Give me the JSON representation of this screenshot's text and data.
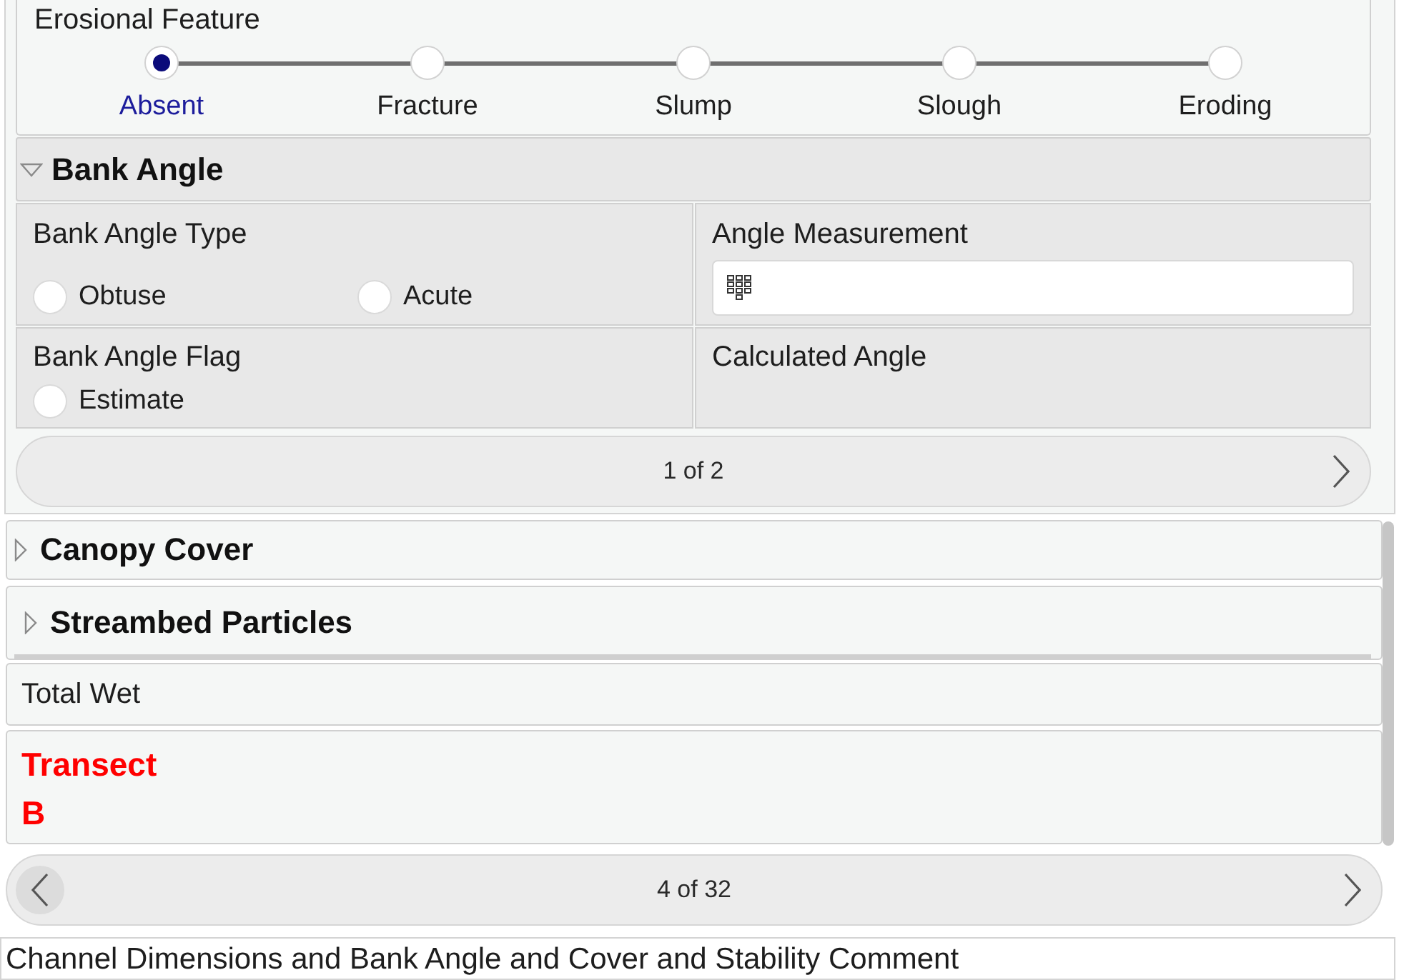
{
  "erosional_feature": {
    "label": "Erosional Feature",
    "options": [
      {
        "label": "Absent",
        "selected": true
      },
      {
        "label": "Fracture",
        "selected": false
      },
      {
        "label": "Slump",
        "selected": false
      },
      {
        "label": "Slough",
        "selected": false
      },
      {
        "label": "Eroding",
        "selected": false
      }
    ]
  },
  "bank_angle": {
    "title": "Bank Angle",
    "expanded": true,
    "fields": [
      {
        "kind": "radio",
        "label": "Bank Angle Type",
        "options": [
          {
            "label": "Obtuse",
            "selected": false
          },
          {
            "label": "Acute",
            "selected": false
          }
        ]
      },
      {
        "kind": "input",
        "label": "Angle Measurement"
      },
      {
        "kind": "checkbox",
        "label": "Bank Angle Flag",
        "options": [
          {
            "label": "Estimate",
            "checked": false
          }
        ]
      },
      {
        "kind": "readout",
        "label": "Calculated Angle"
      }
    ],
    "pager": {
      "text": "1 of 2",
      "has_previous": false,
      "has_next": true
    }
  },
  "sections": [
    {
      "kind": "group",
      "title": "Canopy Cover",
      "expanded": false
    },
    {
      "kind": "subgroup",
      "title": "Streambed Particles",
      "expanded": false
    }
  ],
  "total_wet": {
    "label": "Total Wet"
  },
  "transect": {
    "lines": [
      "Transect",
      "B"
    ]
  },
  "pager": {
    "text": "4 of 32",
    "has_previous": true,
    "has_next": true
  },
  "comment": {
    "label": "Channel Dimensions and Bank Angle and Cover and Stability Comment"
  }
}
